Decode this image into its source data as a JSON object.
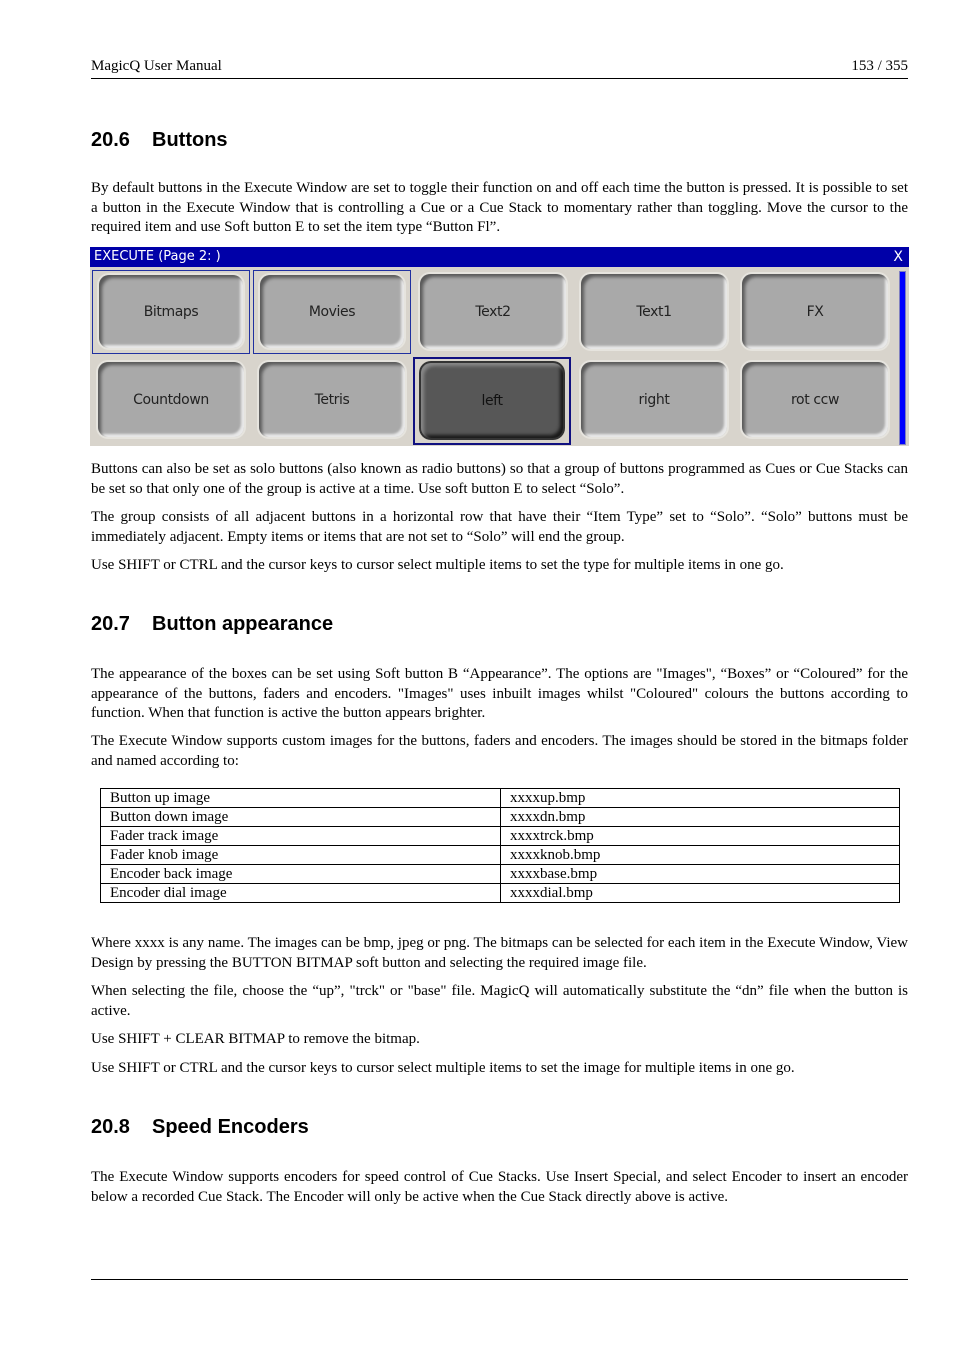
{
  "header": {
    "title": "MagicQ User Manual",
    "page": "153 / 355"
  },
  "sections": [
    {
      "number": "20.6",
      "title": "Buttons"
    },
    {
      "number": "20.7",
      "title": "Button appearance"
    },
    {
      "number": "20.8",
      "title": "Speed Encoders"
    }
  ],
  "paragraphs": {
    "buttons_intro": "By default buttons in the Execute Window are set to toggle their function on and off each time the button is pressed. It is possible to set a button in the Execute Window that is controlling a Cue or a Cue Stack to momentary rather than toggling.  Move the cursor to the required item and use Soft button E to set the item type “Button Fl”.",
    "solo": "Buttons can also be set as solo buttons (also known as radio buttons) so that a group of buttons programmed as Cues or Cue Stacks can be set so that only one of the group is active at a time. Use soft button E to select “Solo”.",
    "group": "The group consists of all adjacent buttons in a horizontal row that have their “Item Type” set to “Solo”. “Solo” buttons must be immediately adjacent. Empty items or items that are not set to “Solo” will end the group.",
    "multi_type": "Use SHIFT or CTRL and the cursor keys to cursor select multiple items to set the type for multiple items in one go.",
    "appearance": "The appearance of the boxes can be set using Soft button B “Appearance”. The options are \"Images\", “Boxes” or “Coloured” for the appearance of the buttons, faders and encoders. \"Images\" uses inbuilt images whilst \"Coloured\" colours the buttons according to function. When that function is active the button appears brighter.",
    "custom_images": "The Execute Window supports custom images for the buttons, faders and encoders. The images should be stored in the bitmaps folder and named according to:",
    "where_xxxx": "Where xxxx is any name. The images can be bmp, jpeg or png. The bitmaps can be selected for each item in the Execute Window, View Design by pressing the BUTTON BITMAP soft button and selecting the required image file.",
    "selecting_file": "When selecting the file, choose the “up”, \"trck\" or \"base\" file. MagicQ will automatically substitute the “dn” file when the button is active.",
    "clear_bitmap": "Use SHIFT + CLEAR BITMAP to remove the bitmap.",
    "multi_image": "Use SHIFT or CTRL and the cursor keys to cursor select multiple items to set the image for multiple items in one go.",
    "encoders": "The Execute Window supports encoders for speed control of Cue Stacks.  Use Insert Special, and select Encoder to insert an encoder below a recorded Cue Stack. The Encoder will only be active when the Cue Stack directly above is active."
  },
  "execute_window": {
    "title": "EXECUTE (Page 2: )",
    "close_label": "X",
    "accent_color": "#0000a8",
    "buttons": [
      {
        "label": "Bitmaps",
        "state": "selected"
      },
      {
        "label": "Movies",
        "state": "selected"
      },
      {
        "label": "Text2",
        "state": "normal"
      },
      {
        "label": "Text1",
        "state": "normal"
      },
      {
        "label": "FX",
        "state": "normal"
      },
      {
        "label": "Countdown",
        "state": "normal"
      },
      {
        "label": "Tetris",
        "state": "normal"
      },
      {
        "label": "left",
        "state": "active"
      },
      {
        "label": "right",
        "state": "normal"
      },
      {
        "label": "rot ccw",
        "state": "normal"
      }
    ]
  },
  "image_table": {
    "rows": [
      [
        "Button up image",
        "xxxxup.bmp"
      ],
      [
        "Button down image",
        "xxxxdn.bmp"
      ],
      [
        "Fader track image",
        "xxxxtrck.bmp"
      ],
      [
        "Fader knob image",
        "xxxxknob.bmp"
      ],
      [
        "Encoder back image",
        "xxxxbase.bmp"
      ],
      [
        "Encoder dial image",
        "xxxxdial.bmp"
      ]
    ]
  }
}
